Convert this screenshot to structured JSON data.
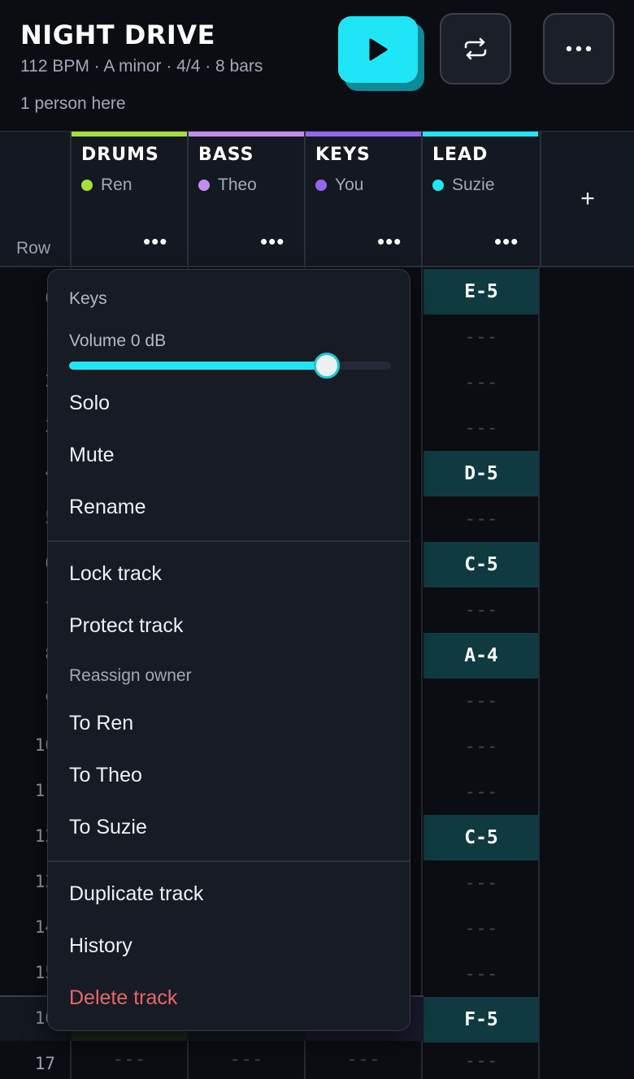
{
  "header": {
    "title": "NIGHT DRIVE",
    "meta": "112 BPM · A minor · 4/4 · 8 bars",
    "presence": "1 person here",
    "buttons": {
      "play_icon": "play-icon",
      "loop_icon": "repeat-icon",
      "more_icon": "more-horizontal-icon",
      "accent_color": "#1ee6f6"
    }
  },
  "tracks": {
    "row_label": "Row",
    "add_label": "+",
    "columns": [
      {
        "name": "DRUMS",
        "owner": "Ren",
        "color": "#a4e03a",
        "more": "•••"
      },
      {
        "name": "BASS",
        "owner": "Theo",
        "color": "#c58cf0",
        "more": "•••"
      },
      {
        "name": "KEYS",
        "owner": "You",
        "color": "#9466f0",
        "more": "•••"
      },
      {
        "name": "LEAD",
        "owner": "Suzie",
        "color": "#1ee6f6",
        "more": "•••"
      }
    ]
  },
  "grid": {
    "row_numbers": [
      "0",
      "1",
      "2",
      "3",
      "4",
      "5",
      "6",
      "7",
      "8",
      "9",
      "10",
      "11",
      "12",
      "13",
      "14",
      "15",
      "16",
      "17"
    ],
    "lead_cells": [
      "E-5",
      "---",
      "---",
      "---",
      "D-5",
      "---",
      "C-5",
      "---",
      "A-4",
      "---",
      "---",
      "---",
      "C-5",
      "---",
      "---",
      "---",
      "F-5",
      "---"
    ],
    "empty_cell": "---"
  },
  "menu": {
    "title": "Keys",
    "volume_label": "Volume 0 dB",
    "volume_level": 0.8,
    "items_top": [
      "Solo",
      "Mute",
      "Rename"
    ],
    "items_mid": [
      "Lock track",
      "Protect track"
    ],
    "reassign_label": "Reassign owner",
    "reassign_items": [
      "To Ren",
      "To Theo",
      "To Suzie"
    ],
    "items_bottom": [
      "Duplicate track",
      "History"
    ],
    "delete_label": "Delete track",
    "delete_color": "#e8666c"
  }
}
